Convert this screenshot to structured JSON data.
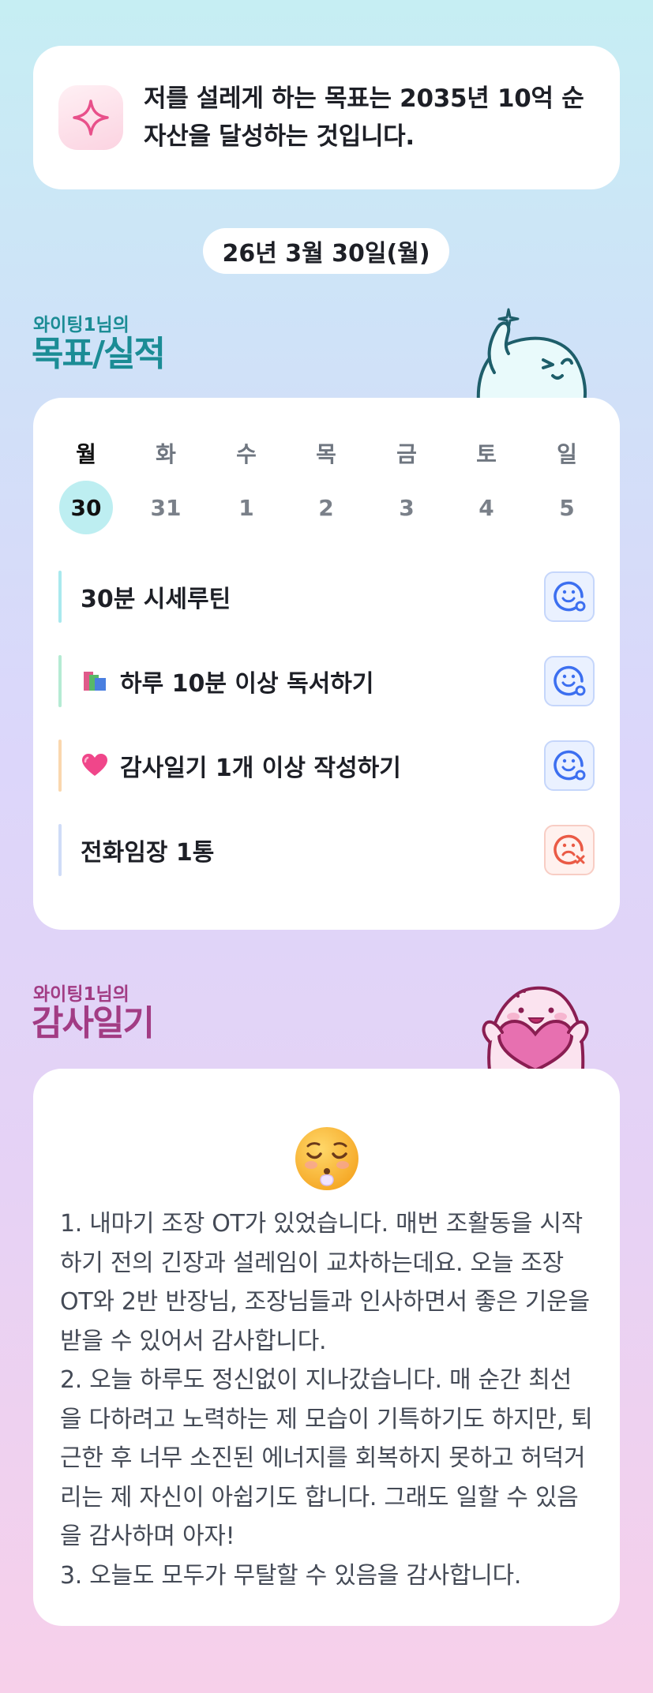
{
  "goal": {
    "icon": "sparkle-icon",
    "text": "저를 설레게 하는 목표는 2035년 10억 순자산을 달성하는 것입니다."
  },
  "date_label": "26년 3월 30일(월)",
  "goals_section": {
    "subtitle": "와이팅1님의",
    "title": "목표/실적"
  },
  "calendar": {
    "weekdays": [
      "월",
      "화",
      "수",
      "목",
      "금",
      "토",
      "일"
    ],
    "days": [
      "30",
      "31",
      "1",
      "2",
      "3",
      "4",
      "5"
    ],
    "selected_index": 0
  },
  "tasks": [
    {
      "label": "30분 시세루틴",
      "emoji": "",
      "status": "done",
      "status_icon": "smile-check-icon",
      "bar_color": "#a9e9ee"
    },
    {
      "label": "하루 10분 이상 독서하기",
      "emoji": "books-icon",
      "status": "done",
      "status_icon": "smile-check-icon",
      "bar_color": "#b5ebd3"
    },
    {
      "label": "감사일기 1개 이상 작성하기",
      "emoji": "heart-icon",
      "status": "done",
      "status_icon": "smile-check-icon",
      "bar_color": "#fad7ae"
    },
    {
      "label": "전화임장 1통",
      "emoji": "",
      "status": "failed",
      "status_icon": "sad-x-icon",
      "bar_color": "#cfdcf7"
    }
  ],
  "diary_section": {
    "subtitle": "와이팅1님의",
    "title": "감사일기"
  },
  "diary": {
    "emoji": "relieved-face-icon",
    "text": "1. 내마기 조장 OT가 있었습니다. 매번 조활동을 시작하기 전의 긴장과 설레임이 교차하는데요. 오늘 조장 OT와 2반 반장님, 조장님들과 인사하면서 좋은 기운을 받을 수 있어서 감사합니다.\n2. 오늘 하루도 정신없이 지나갔습니다. 매 순간 최선을 다하려고 노력하는 제 모습이 기특하기도 하지만, 퇴근한 후 너무 소진된 에너지를 회복하지 못하고 허덕거리는 제 자신이 아쉽기도 합니다. 그래도 일할 수 있음을 감사하며 아자!\n3. 오늘도 모두가 무탈할 수 있음을 감사합니다."
  },
  "colors": {
    "accent_teal": "#1b8c95",
    "accent_magenta": "#a23c84",
    "status_ok": "#3c6ff0",
    "status_bad": "#ea5a45"
  }
}
